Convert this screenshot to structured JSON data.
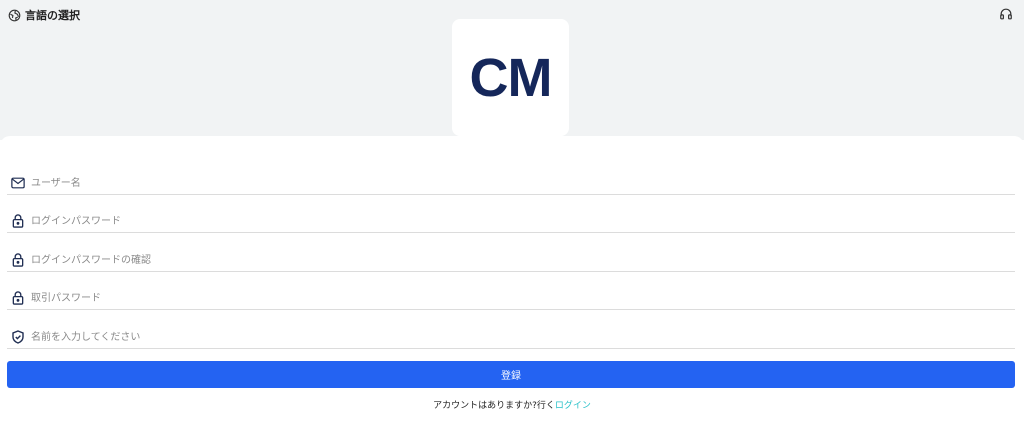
{
  "header": {
    "language_label": "言語の選択",
    "language_icon": "globe-icon",
    "support_icon": "headphones-icon"
  },
  "logo": {
    "text": "CM",
    "color": "#15275a"
  },
  "form": {
    "username": {
      "placeholder": "ユーザー名",
      "value": "",
      "icon": "mail-icon"
    },
    "login_password": {
      "placeholder": "ログインパスワード",
      "value": "",
      "icon": "lock-icon"
    },
    "login_password_confirm": {
      "placeholder": "ログインパスワードの確認",
      "value": "",
      "icon": "lock-icon"
    },
    "trade_password": {
      "placeholder": "取引パスワード",
      "value": "",
      "icon": "lock-icon"
    },
    "name": {
      "placeholder": "名前を入力してください",
      "value": "",
      "icon": "shield-check-icon"
    },
    "submit_label": "登録"
  },
  "footer": {
    "prompt": "アカウントはありますか?行く",
    "login_link": "ログイン"
  },
  "colors": {
    "primary": "#2463f2",
    "link": "#2bc1c9",
    "header_bg": "#f1f3f4"
  }
}
